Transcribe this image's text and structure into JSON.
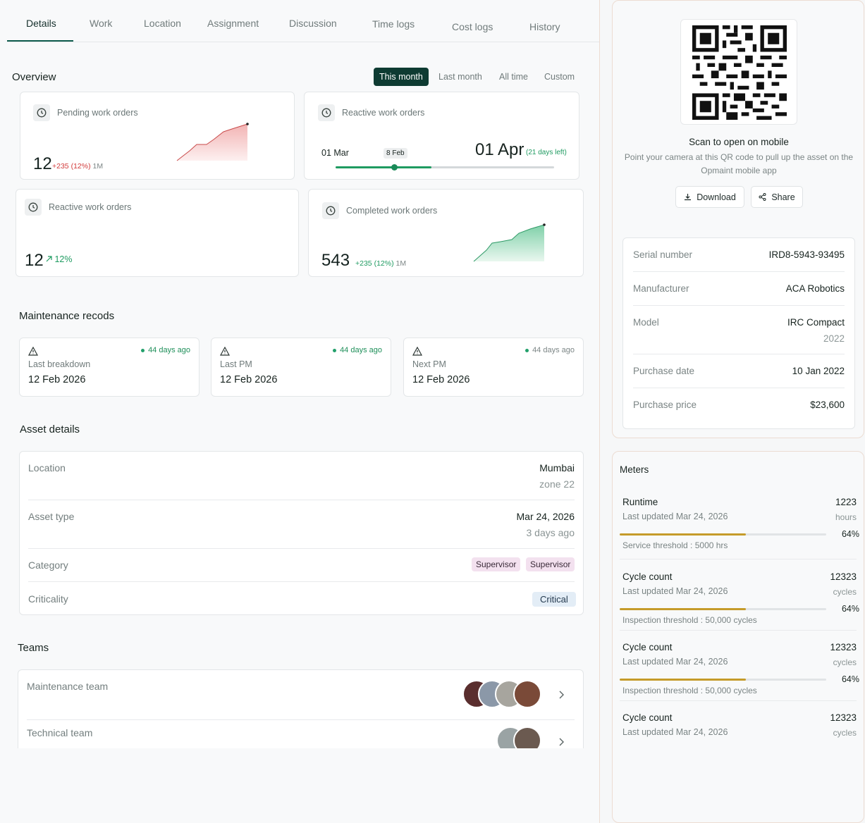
{
  "tabs": [
    "Details",
    "Work",
    "Location",
    "Assignment",
    "Discussion",
    "Time logs",
    "Cost logs",
    "History"
  ],
  "overview": {
    "title": "Overview",
    "ranges": [
      "This month",
      "Last month",
      "All time",
      "Custom"
    ],
    "pending": {
      "label": "Pending work orders",
      "value": "12",
      "delta": "+235 (12%)",
      "period": "1M"
    },
    "reactive_timeline": {
      "label": "Reactive work orders",
      "start": "01 Mar",
      "marker": "8 Feb",
      "end": "01 Apr",
      "remaining": "(21 days left)",
      "progress": 0.44
    },
    "reactive": {
      "label": "Reactive work orders",
      "value": "12",
      "pct": "12%"
    },
    "completed": {
      "label": "Completed work orders",
      "value": "543",
      "delta": "+235 (12%)",
      "period": "1M"
    }
  },
  "maintenance": {
    "title": "Maintenance recods",
    "records": [
      {
        "ago": "44 days ago",
        "label": "Last breakdown",
        "date": "12 Feb 2026"
      },
      {
        "ago": "44 days ago",
        "label": "Last PM",
        "date": "12 Feb 2026"
      },
      {
        "ago": "44 days ago",
        "label": "Next PM",
        "date": "12 Feb 2026"
      }
    ]
  },
  "asset": {
    "title": "Asset details",
    "location_label": "Location",
    "location": "Mumbai",
    "zone": "zone 22",
    "type_label": "Asset type",
    "type_date": "Mar 24, 2026",
    "type_ago": "3 days ago",
    "category_label": "Category",
    "categories": [
      "Supervisor",
      "Supervisor"
    ],
    "criticality_label": "Criticality",
    "criticality": "Critical"
  },
  "teams": {
    "title": "Teams",
    "items": [
      "Maintenance team",
      "Technical team"
    ]
  },
  "qr": {
    "title": "Scan to open on mobile",
    "desc_line1": "Point your camera at this QR code to pull up the asset on the",
    "desc_line2": "Opmaint mobile app",
    "download": "Download",
    "share": "Share"
  },
  "info": {
    "serial_label": "Serial number",
    "serial": "IRD8-5943-93495",
    "manufacturer_label": "Manufacturer",
    "manufacturer": "ACA Robotics",
    "model_label": "Model",
    "model": "IRC Compact",
    "model_year": "2022",
    "purchase_date_label": "Purchase date",
    "purchase_date": "10 Jan 2022",
    "purchase_price_label": "Purchase price",
    "purchase_price": "$23,600"
  },
  "meters": {
    "title": "Meters",
    "items": [
      {
        "name": "Runtime",
        "updated": "Last updated Mar 24, 2026",
        "value": "1223",
        "unit": "hours",
        "pct": "64%",
        "fill": 0.61,
        "threshold": "Service threshold : 5000 hrs"
      },
      {
        "name": "Cycle count",
        "updated": "Last updated Mar 24, 2026",
        "value": "12323",
        "unit": "cycles",
        "pct": "64%",
        "fill": 0.61,
        "threshold": "Inspection threshold : 50,000 cycles"
      },
      {
        "name": "Cycle count",
        "updated": "Last updated Mar 24, 2026",
        "value": "12323",
        "unit": "cycles",
        "pct": "64%",
        "fill": 0.61,
        "threshold": "Inspection threshold : 50,000 cycles"
      },
      {
        "name": "Cycle count",
        "updated": "Last updated Mar 24, 2026",
        "value": "12323",
        "unit": "cycles"
      }
    ]
  },
  "colors": {
    "accent": "#0e3b32",
    "positive": "#1f9b61",
    "negative": "#d23b3b",
    "meter": "#c59b2a"
  }
}
